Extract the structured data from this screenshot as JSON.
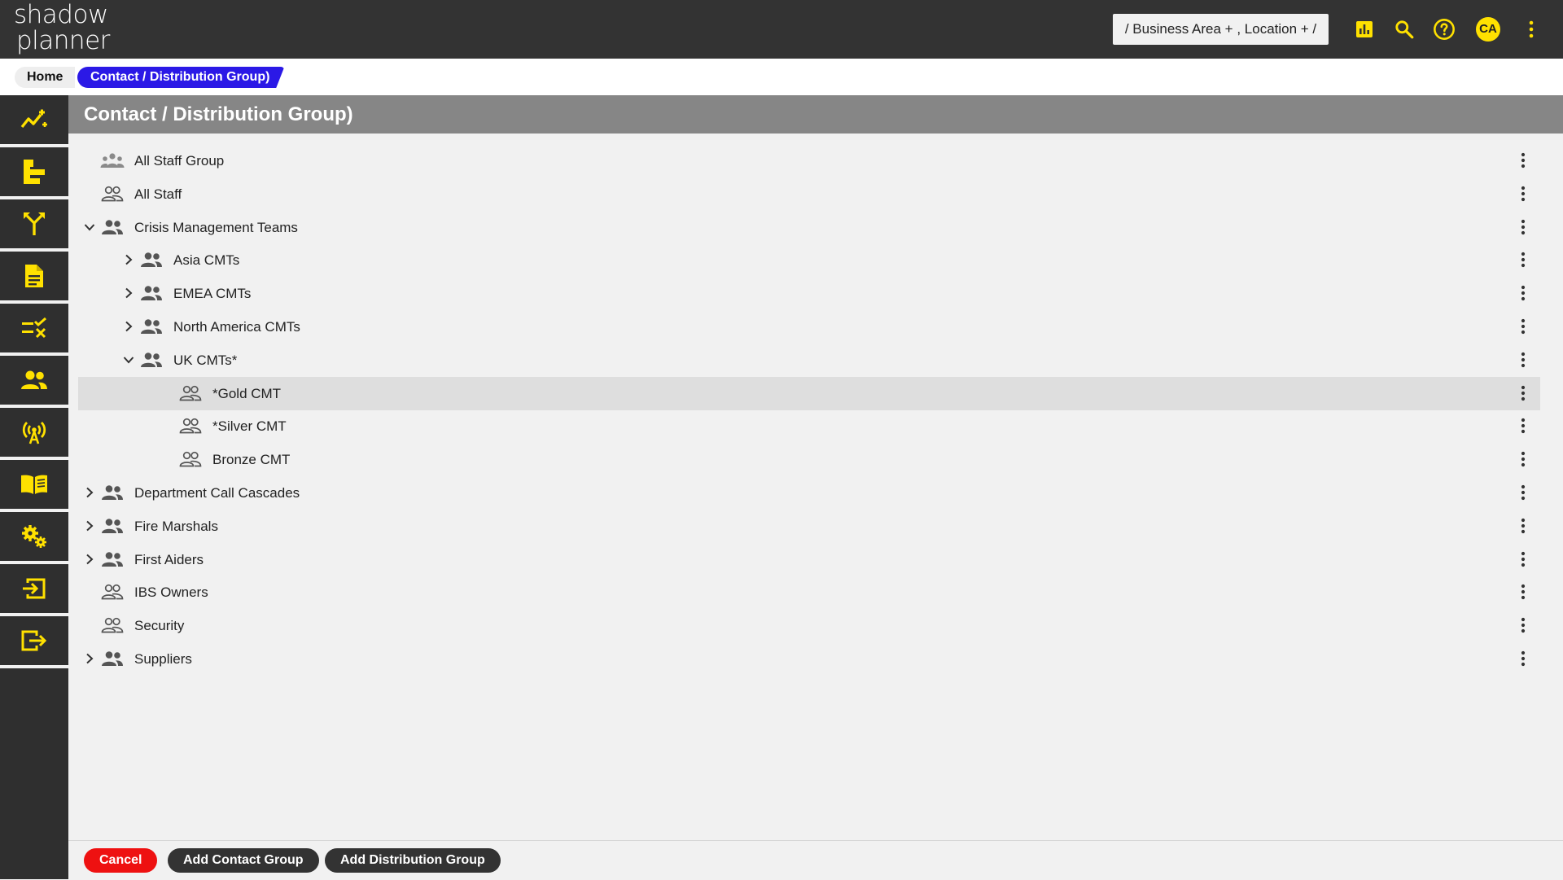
{
  "app": {
    "logo_line1": "shadow",
    "logo_line2": "planner",
    "context_selector": "/ Business Area + , Location + /",
    "avatar_initials": "CA"
  },
  "breadcrumb": {
    "home": "Home",
    "current": "Contact / Distribution Group)"
  },
  "page": {
    "title": "Contact / Distribution Group)"
  },
  "tree": [
    {
      "label": "All Staff Group",
      "icon": "people-group-icon",
      "expander": "none",
      "depth": 0
    },
    {
      "label": "All Staff",
      "icon": "people-outline-icon",
      "expander": "none",
      "depth": 0
    },
    {
      "label": "Crisis Management Teams",
      "icon": "people-filled-icon",
      "expander": "expanded",
      "depth": 0
    },
    {
      "label": "Asia CMTs",
      "icon": "people-filled-icon",
      "expander": "collapsed",
      "depth": 1
    },
    {
      "label": "EMEA CMTs",
      "icon": "people-filled-icon",
      "expander": "collapsed",
      "depth": 1
    },
    {
      "label": "North America CMTs",
      "icon": "people-filled-icon",
      "expander": "collapsed",
      "depth": 1
    },
    {
      "label": "UK CMTs*",
      "icon": "people-filled-icon",
      "expander": "expanded",
      "depth": 1
    },
    {
      "label": "*Gold CMT",
      "icon": "people-outline-icon",
      "expander": "none",
      "depth": 2,
      "selected": true
    },
    {
      "label": "*Silver CMT",
      "icon": "people-outline-icon",
      "expander": "none",
      "depth": 2
    },
    {
      "label": "Bronze CMT",
      "icon": "people-outline-icon",
      "expander": "none",
      "depth": 2
    },
    {
      "label": "Department Call Cascades",
      "icon": "people-filled-icon",
      "expander": "collapsed",
      "depth": 0
    },
    {
      "label": "Fire Marshals",
      "icon": "people-filled-icon",
      "expander": "collapsed",
      "depth": 0
    },
    {
      "label": "First Aiders",
      "icon": "people-filled-icon",
      "expander": "collapsed",
      "depth": 0
    },
    {
      "label": "IBS Owners",
      "icon": "people-outline-icon",
      "expander": "none",
      "depth": 0
    },
    {
      "label": "Security",
      "icon": "people-outline-icon",
      "expander": "none",
      "depth": 0
    },
    {
      "label": "Suppliers",
      "icon": "people-filled-icon",
      "expander": "collapsed",
      "depth": 0
    }
  ],
  "sidebar": {
    "items": [
      {
        "icon": "analytics-icon"
      },
      {
        "icon": "hierarchy-icon"
      },
      {
        "icon": "fork-icon"
      },
      {
        "icon": "document-icon"
      },
      {
        "icon": "checklist-icon"
      },
      {
        "icon": "people-icon"
      },
      {
        "icon": "broadcast-icon"
      },
      {
        "icon": "book-icon"
      },
      {
        "icon": "settings-icon"
      },
      {
        "icon": "login-icon"
      },
      {
        "icon": "logout-icon"
      }
    ]
  },
  "footer": {
    "cancel": "Cancel",
    "add_contact_group": "Add Contact Group",
    "add_distribution_group": "Add Distribution Group"
  },
  "colors": {
    "accent_yellow": "#FFE100",
    "breadcrumb_active": "#2B19E6",
    "cancel_red": "#EE1111",
    "topbar": "#333333",
    "header_grey": "#868686"
  }
}
